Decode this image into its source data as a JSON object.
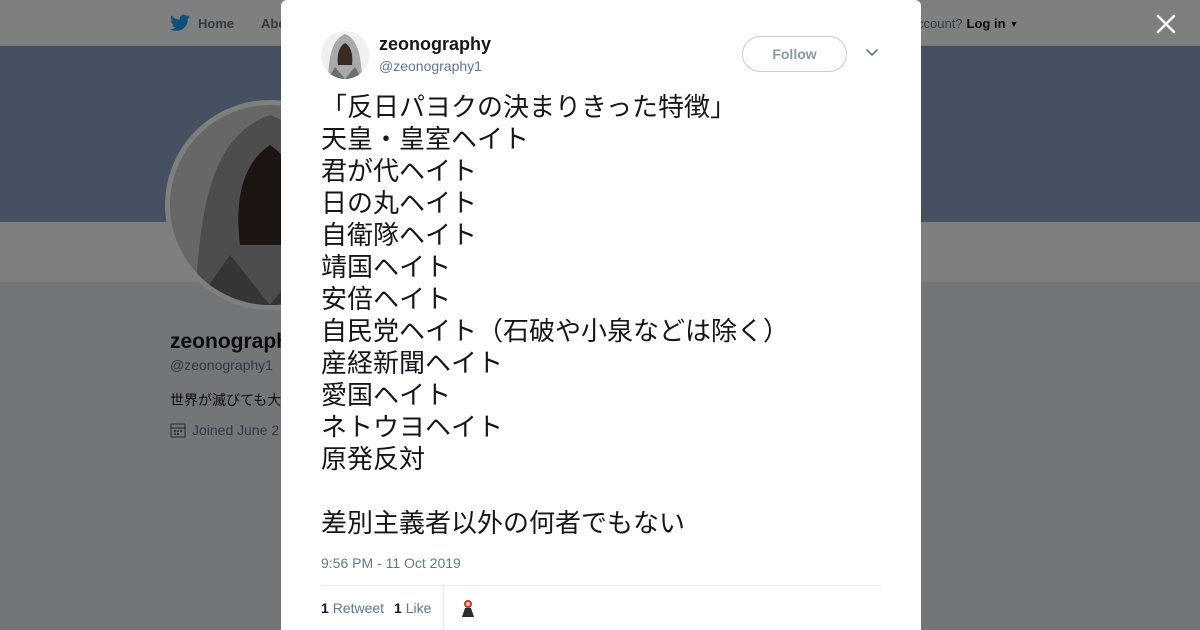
{
  "background": {
    "nav": {
      "home_label": "Home",
      "about_label": "Abo",
      "account_prompt": "ccount?",
      "login_label": "Log in"
    },
    "profile": {
      "name": "zeonograph",
      "handle": "@zeonography1",
      "bio": "世界が滅びても大",
      "joined": "Joined June 2"
    }
  },
  "tweet": {
    "user": {
      "name": "zeonography",
      "handle": "@zeonography1"
    },
    "follow_label": "Follow",
    "lines": [
      "「反日パヨクの決まりきった特徴」",
      "天皇・皇室ヘイト",
      "君が代ヘイト",
      "日の丸ヘイト",
      "自衛隊ヘイト",
      "靖国ヘイト",
      "安倍ヘイト",
      "自民党ヘイト（石破や小泉などは除く）",
      "産経新聞ヘイト",
      "愛国ヘイト",
      "ネトウヨヘイト",
      "原発反対"
    ],
    "closing_line": "差別主義者以外の何者でもない",
    "timestamp": "9:56 PM - 11 Oct 2019",
    "stats": {
      "retweets_count": "1",
      "retweets_label": "Retweet",
      "likes_count": "1",
      "likes_label": "Like"
    }
  },
  "colors": {
    "twitter_blue": "#1da1f2",
    "text_primary": "#14171a",
    "text_secondary": "#657786"
  },
  "icons": {
    "logo": "twitter-bird-icon",
    "close": "close-icon",
    "caret": "chevron-down-icon",
    "calendar": "calendar-icon"
  }
}
